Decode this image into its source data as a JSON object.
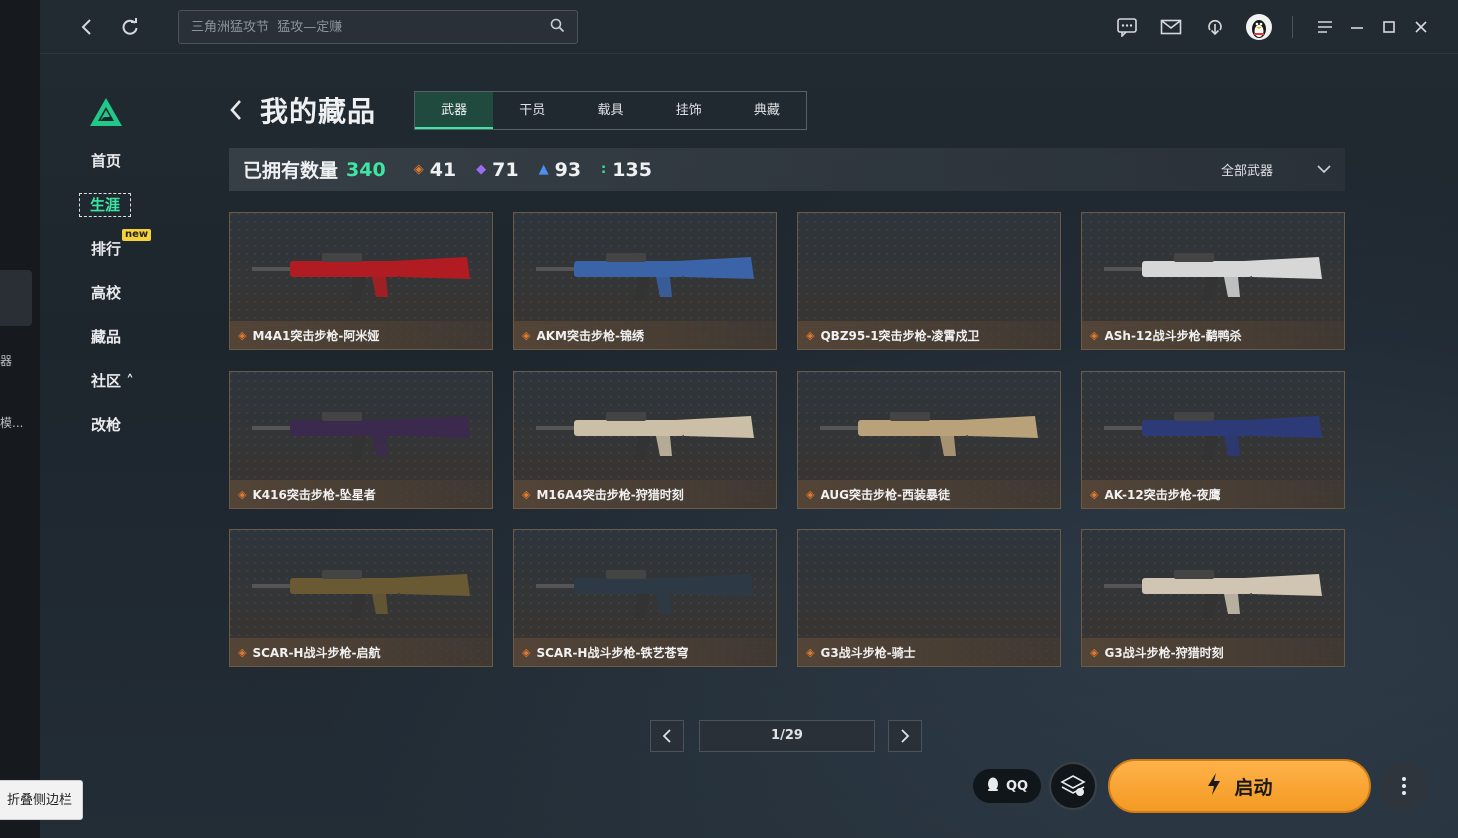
{
  "titlebar": {
    "search_placeholder": "三角洲猛攻节  猛攻—定赚",
    "icons": [
      "back-icon",
      "refresh-icon",
      "search-icon",
      "chat-icon",
      "mail-icon",
      "download-icon",
      "avatar",
      "menu-icon",
      "minimize-icon",
      "maximize-icon",
      "close-icon"
    ]
  },
  "outer": {
    "text1": "器",
    "text2": "模...",
    "fold_tooltip": "折叠侧边栏"
  },
  "sidebar": {
    "items": [
      {
        "label": "首页"
      },
      {
        "label": "生涯"
      },
      {
        "label": "排行",
        "badge": "new"
      },
      {
        "label": "高校"
      },
      {
        "label": "藏品"
      },
      {
        "label": "社区 ˄"
      },
      {
        "label": "改枪"
      }
    ]
  },
  "header": {
    "title": "我的藏品",
    "tabs": [
      "武器",
      "干员",
      "载具",
      "挂饰",
      "典藏"
    ]
  },
  "stats": {
    "label": "已拥有数量",
    "total": "340",
    "tiers": [
      {
        "value": "41",
        "color": "#e27a2f"
      },
      {
        "value": "71",
        "color": "#9b6cf0"
      },
      {
        "value": "93",
        "color": "#4b8ff0"
      },
      {
        "value": "135",
        "color": "#3ee6a4"
      }
    ],
    "filter_label": "全部武器"
  },
  "cards": [
    {
      "name": "M4A1突击步枪-阿米娅",
      "color": "#b01c22"
    },
    {
      "name": "AKM突击步枪-锦绣",
      "color": "#3a63a8"
    },
    {
      "name": "QBZ95-1突击步枪-凌霄戍卫",
      "color": ""
    },
    {
      "name": "ASh-12战斗步枪-鹬鸭杀",
      "color": "#d7d7d7"
    },
    {
      "name": "K416突击步枪-坠星者",
      "color": "#3b2a4e"
    },
    {
      "name": "M16A4突击步枪-狩猎时刻",
      "color": "#cbbfa8"
    },
    {
      "name": "AUG突击步枪-西装暴徒",
      "color": "#b9a27a"
    },
    {
      "name": "AK-12突击步枪-夜鹰",
      "color": "#2c3a78"
    },
    {
      "name": "SCAR-H战斗步枪-启航",
      "color": "#6a5a34"
    },
    {
      "name": "SCAR-H战斗步枪-铁艺苍穹",
      "color": "#2d3a45"
    },
    {
      "name": "G3战斗步枪-骑士",
      "color": ""
    },
    {
      "name": "G3战斗步枪-狩猎时刻",
      "color": "#cfc5b2"
    }
  ],
  "pagination": {
    "current": "1/29"
  },
  "bottom": {
    "qq_label": "QQ",
    "launch_label": "启动"
  }
}
